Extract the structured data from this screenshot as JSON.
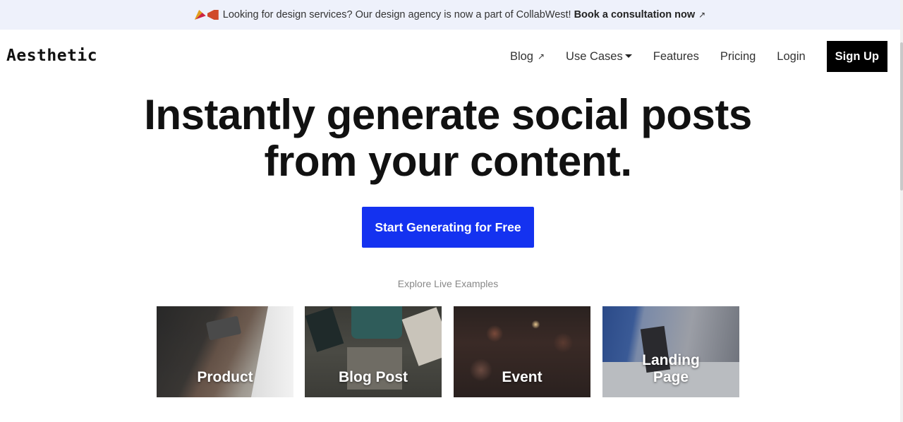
{
  "announcement": {
    "text": "Looking for design services? Our design agency is now a part of CollabWest!",
    "link_text": "Book a consultation now",
    "link_icon": "arrow-up-right-icon"
  },
  "nav": {
    "logo": "Aesthetic",
    "items": [
      {
        "label": "Blog",
        "icon": "arrow-up-right-icon"
      },
      {
        "label": "Use Cases",
        "icon": "caret-down-icon"
      },
      {
        "label": "Features"
      },
      {
        "label": "Pricing"
      },
      {
        "label": "Login"
      }
    ],
    "signup_label": "Sign Up"
  },
  "hero": {
    "title_line1": "Instantly generate social posts",
    "title_line2": "from your content.",
    "cta_label": "Start Generating for Free",
    "explore_label": "Explore Live Examples"
  },
  "examples": [
    {
      "label": "Product"
    },
    {
      "label": "Blog Post"
    },
    {
      "label": "Event"
    },
    {
      "label": "Landing Page"
    }
  ],
  "colors": {
    "cta": "#1432f0",
    "announcement_bg": "#eef1fb",
    "signup_bg": "#000000"
  }
}
